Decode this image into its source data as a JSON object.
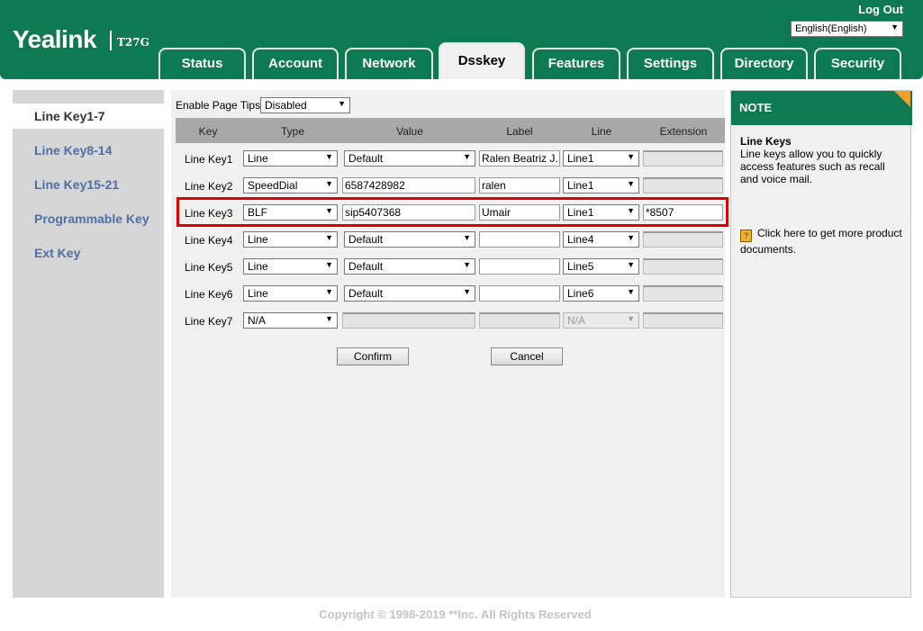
{
  "header": {
    "logo": "Yealink",
    "model": "T27G",
    "logout": "Log Out",
    "language": "English(English)"
  },
  "tabs": [
    {
      "label": "Status"
    },
    {
      "label": "Account"
    },
    {
      "label": "Network"
    },
    {
      "label": "Dsskey"
    },
    {
      "label": "Features"
    },
    {
      "label": "Settings"
    },
    {
      "label": "Directory"
    },
    {
      "label": "Security"
    }
  ],
  "active_tab": "Dsskey",
  "sidebar": {
    "items": [
      {
        "label": "Line Key1-7"
      },
      {
        "label": "Line Key8-14"
      },
      {
        "label": "Line Key15-21"
      },
      {
        "label": "Programmable Key"
      },
      {
        "label": "Ext Key"
      }
    ],
    "active": "Line Key1-7"
  },
  "main": {
    "page_tips_label": "Enable Page Tips",
    "page_tips_value": "Disabled",
    "columns": [
      "Key",
      "Type",
      "Value",
      "Label",
      "Line",
      "Extension"
    ],
    "rows": [
      {
        "key": "Line Key1",
        "type": "Line",
        "value": "Default",
        "label": "Ralen Beatriz J.",
        "line": "Line1",
        "extension": ""
      },
      {
        "key": "Line Key2",
        "type": "SpeedDial",
        "value": "6587428982",
        "label": "ralen",
        "line": "Line1",
        "extension": ""
      },
      {
        "key": "Line Key3",
        "type": "BLF",
        "value": "sip5407368",
        "label": "Umair",
        "line": "Line1",
        "extension": "*8507"
      },
      {
        "key": "Line Key4",
        "type": "Line",
        "value": "Default",
        "label": "",
        "line": "Line4",
        "extension": ""
      },
      {
        "key": "Line Key5",
        "type": "Line",
        "value": "Default",
        "label": "",
        "line": "Line5",
        "extension": ""
      },
      {
        "key": "Line Key6",
        "type": "Line",
        "value": "Default",
        "label": "",
        "line": "Line6",
        "extension": ""
      },
      {
        "key": "Line Key7",
        "type": "N/A",
        "value": "",
        "label": "",
        "line": "N/A",
        "extension": ""
      }
    ],
    "confirm": "Confirm",
    "cancel": "Cancel"
  },
  "note": {
    "heading": "NOTE",
    "title": "Line Keys",
    "text": "Line keys allow you to quickly access features such as recall and voice mail.",
    "doc_link": "Click here to get more product documents."
  },
  "footer": "Copyright © 1998-2019 **Inc. All Rights Reserved",
  "colors": {
    "brand_green": "#0e7a52",
    "sidebar_link": "#4b6fa6",
    "highlight_red": "#e00000",
    "note_corner": "#f0a02a"
  },
  "icons": {
    "dropdown": "triangle-down",
    "document": "document-icon"
  }
}
